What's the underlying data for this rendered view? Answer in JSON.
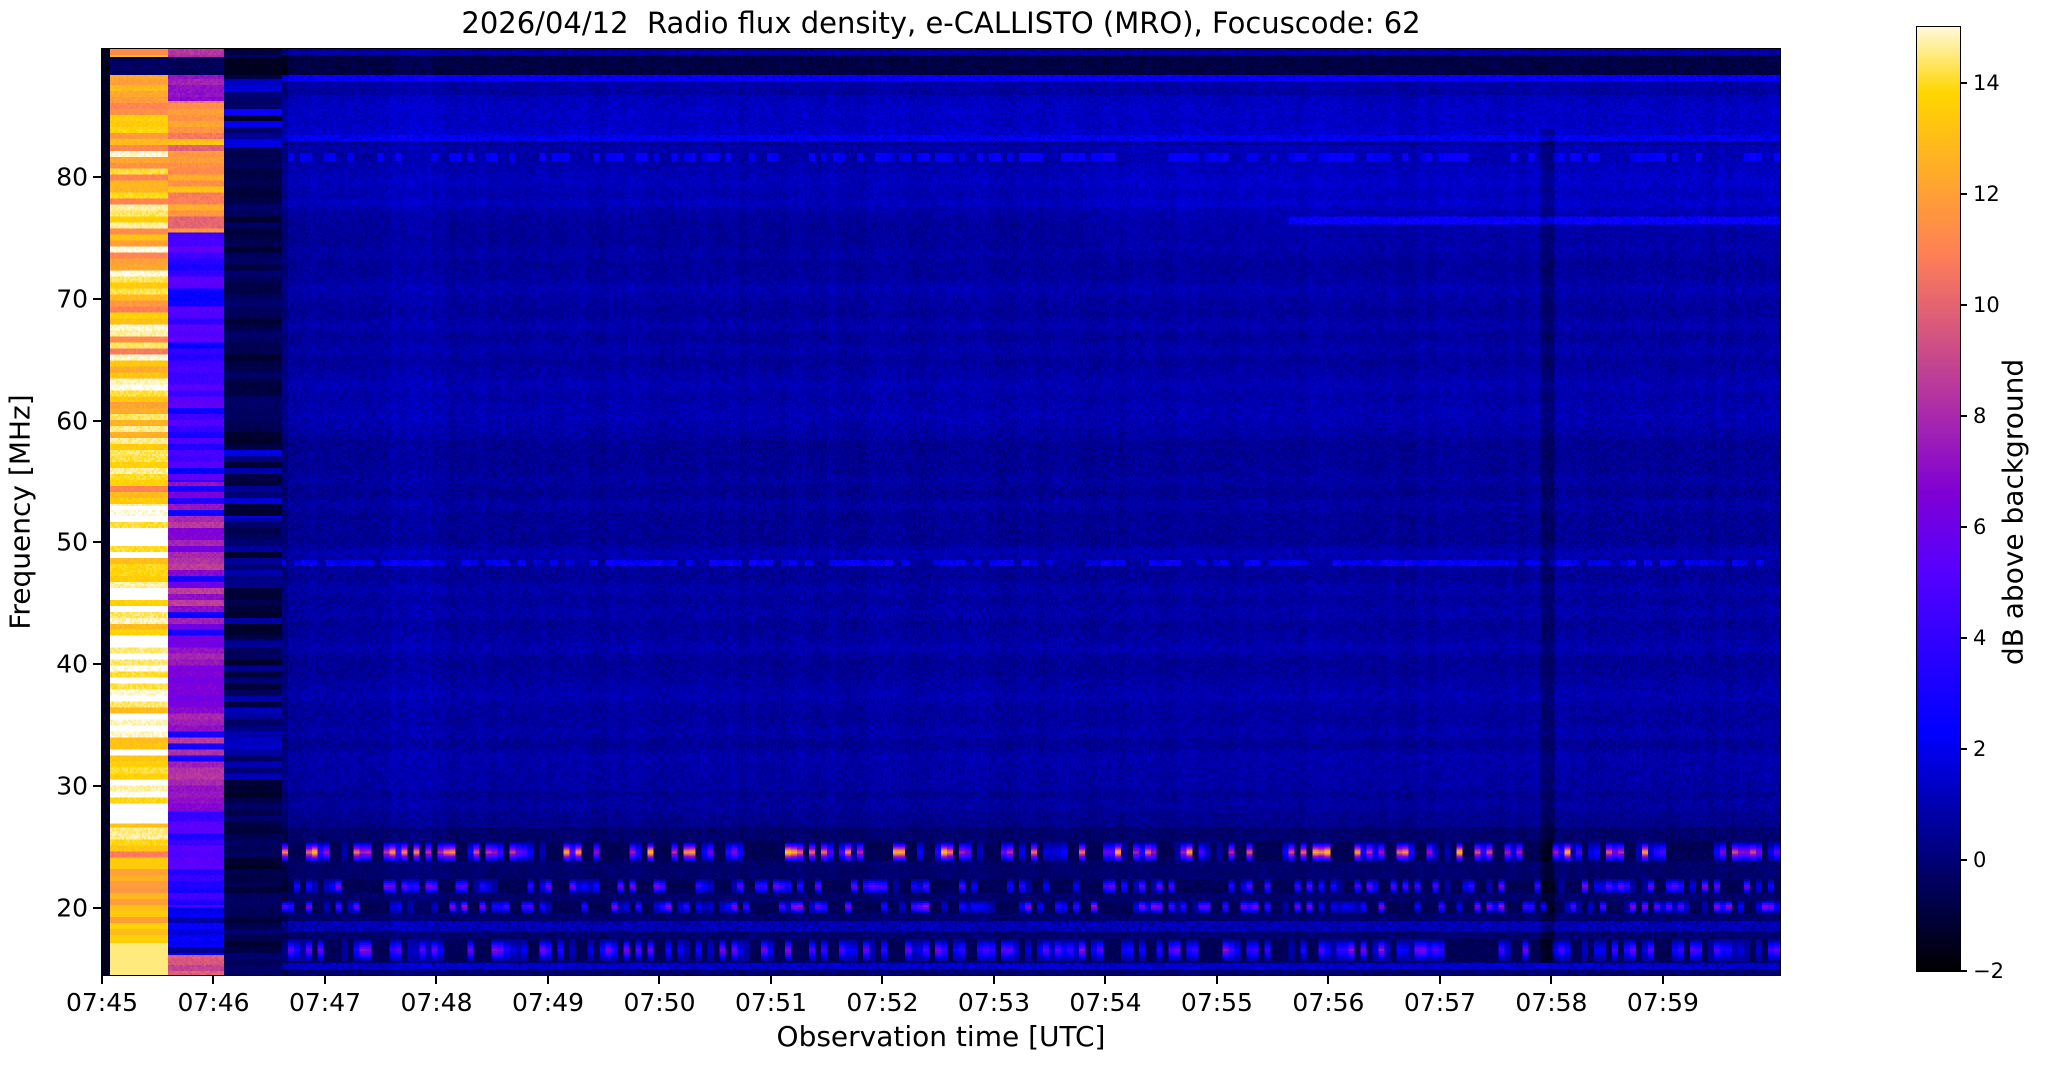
{
  "chart_data": {
    "type": "heatmap",
    "subtype": "radio-spectrogram",
    "title": "2026/04/12  Radio flux density, e-CALLISTO (MRO), Focuscode: 62",
    "xlabel": "Observation time [UTC]",
    "ylabel": "Frequency [MHz]",
    "colorbar_label": "dB above background",
    "colormap": "gnuplot2",
    "grid": false,
    "x_tick_labels": [
      "07:45",
      "07:46",
      "07:47",
      "07:48",
      "07:49",
      "07:50",
      "07:51",
      "07:52",
      "07:53",
      "07:54",
      "07:55",
      "07:56",
      "07:57",
      "07:58",
      "07:59"
    ],
    "x_range_minutes": [
      0,
      15.05
    ],
    "x_start_time_utc": "07:45",
    "y_ticks_mhz": [
      80,
      70,
      60,
      50,
      40,
      30,
      20
    ],
    "y_range_mhz": [
      14.5,
      90.5
    ],
    "colorbar_ticks": [
      14,
      12,
      10,
      8,
      6,
      4,
      2,
      0,
      -2
    ],
    "colorbar_tick_labels": [
      "14",
      "12",
      "10",
      "8",
      "6",
      "4",
      "2",
      "0",
      "−2"
    ],
    "colorbar_range_db": [
      -2,
      15
    ],
    "background_level_db": [
      0,
      1.5
    ],
    "features": {
      "calibration_sequence": [
        {
          "start_min": 0.0,
          "end_min": 0.07,
          "kind": "gap",
          "level_db": -1.6
        },
        {
          "start_min": 0.07,
          "end_min": 0.59,
          "kind": "bright",
          "level_db_range": [
            10,
            15
          ]
        },
        {
          "start_min": 0.59,
          "end_min": 1.09,
          "kind": "medium",
          "level_db_range": [
            2,
            13
          ]
        },
        {
          "start_min": 1.09,
          "end_min": 1.61,
          "kind": "dark",
          "level_db_range": [
            -1.6,
            3
          ]
        }
      ],
      "dark_band_mhz": [
        88.45,
        90.0
      ],
      "top_speckle_row_mhz": [
        90.0,
        90.5
      ],
      "horizontal_lines_mhz": [
        {
          "f": [
            87.95,
            88.45
          ],
          "level_db": 2.4
        },
        {
          "f": [
            83.0,
            83.5
          ],
          "level_db": 2.1
        },
        {
          "f": [
            81.3,
            82.0
          ],
          "level_db": 1.9,
          "speckled": true
        },
        {
          "f": [
            76.15,
            76.7
          ],
          "level_db": 2.5,
          "start_min": 10.65
        },
        {
          "f": [
            48.1,
            48.6
          ],
          "level_db": 2.3,
          "dashed": true
        },
        {
          "f": [
            18.15,
            18.85
          ],
          "level_db": 1.0
        },
        {
          "f": [
            15.0,
            15.55
          ],
          "level_db": 1.4
        }
      ],
      "rfi_speckle_bands_mhz": [
        {
          "f": [
            23.8,
            25.4
          ],
          "peak_db": 13.5,
          "threshold": 0.45
        },
        {
          "f": [
            21.2,
            22.35
          ],
          "peak_db": 6.5,
          "threshold": 0.5
        },
        {
          "f": [
            19.6,
            20.6
          ],
          "peak_db": 7.5,
          "threshold": 0.5
        },
        {
          "f": [
            15.7,
            17.4
          ],
          "peak_db": 6.8,
          "threshold": 0.48
        }
      ],
      "vertical_dark_streak_min": {
        "start_min": 12.9,
        "end_min": 13.03,
        "f": [
          15.5,
          84
        ],
        "delta_db": -0.9
      },
      "vertical_bright_zone_min": {
        "start_min": 2.6,
        "end_min": 2.95,
        "delta_db": 0.25
      },
      "low_freq_dark_zone_mhz": [
        15,
        26.6
      ]
    }
  }
}
